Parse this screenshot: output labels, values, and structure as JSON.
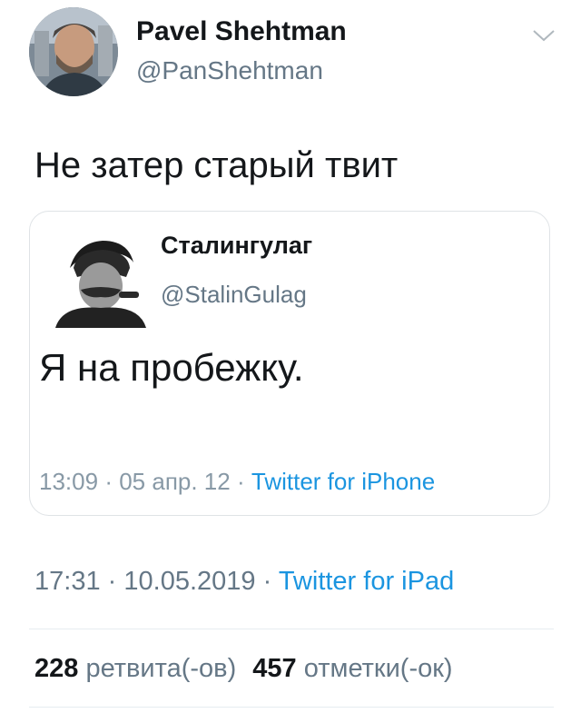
{
  "author": {
    "display_name": "Pavel Shehtman",
    "handle": "@PanShehtman",
    "avatar_icon": "user-photo-avatar"
  },
  "tweet": {
    "text": "Не затер старый твит",
    "time": "17:31",
    "date": "10.05.2019",
    "separator": "·",
    "source": "Twitter for iPad"
  },
  "quoted_tweet": {
    "display_name": "Сталингулаг",
    "handle": "@StalinGulag",
    "text": "Я на пробежку.",
    "time": "13:09",
    "date": "05 апр. 12",
    "source": "Twitter for iPhone",
    "avatar_icon": "portrait-avatar"
  },
  "stats": {
    "retweets_count": "228",
    "retweets_label": "ретвита(-ов)",
    "likes_count": "457",
    "likes_label": "отметки(-ок)"
  },
  "colors": {
    "link": "#1b95e0",
    "secondary_text": "#657786",
    "border": "#dfe3e6"
  },
  "icons": {
    "menu": "chevron-down-icon"
  }
}
